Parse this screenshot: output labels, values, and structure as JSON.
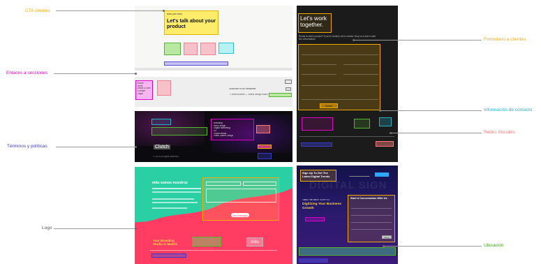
{
  "callouts": {
    "cta": "CTA clientes",
    "sections": "Enlaces a secciones",
    "terms": "Términos y políticas",
    "logo": "Logo",
    "form": "Formulario a clientes",
    "contact": "Información de contacto",
    "social": "Redes Sociales",
    "location": "Ubicación"
  },
  "colors": {
    "cta": "#f2a900",
    "sections": "#e000c8",
    "terms": "#3a3acc",
    "logo": "#555555",
    "form": "#f2a900",
    "contact": "#22b5c9",
    "social": "#ff7a7a",
    "location": "#3fa318"
  },
  "panel1": {
    "small": "Build your story",
    "headline": "Let's talk about your product"
  },
  "panel2": {
    "subscribe": "Subscribe to our newsletter",
    "brand_line": "© BrandStories — Brand design studio",
    "links": [
      "Home",
      "Work",
      "About & Services",
      "Contact",
      "Legal"
    ]
  },
  "panel3": {
    "clutch": "Clutch",
    "menu": [
      "Branding",
      "Web Design",
      "Digital Marketing",
      "UX",
      "Social Media",
      "Video Game Design"
    ],
    "rights": "© 2023 All rights reserved"
  },
  "panel4": {
    "title": "mitu somos nosotros",
    "tagline": "Your Branding Studio in Madrid",
    "logo": "mitu",
    "send": "Send message"
  },
  "panel5": {
    "headline": "Let's work together.",
    "intro": "Ready to start a project? If you're excited, we're excited. Drop us a line to start the conversation.",
    "submit": "Submit"
  },
  "panel6": {
    "signup": "Sign Up To Get The Latest Digital Trends",
    "start": "Start A Conversation With Us",
    "take": "TAKE THE NEXT STEP TO",
    "digitize": "Digitizing Your Business Growth",
    "watermark": "DIGITAL SIGN",
    "send": "Send"
  }
}
